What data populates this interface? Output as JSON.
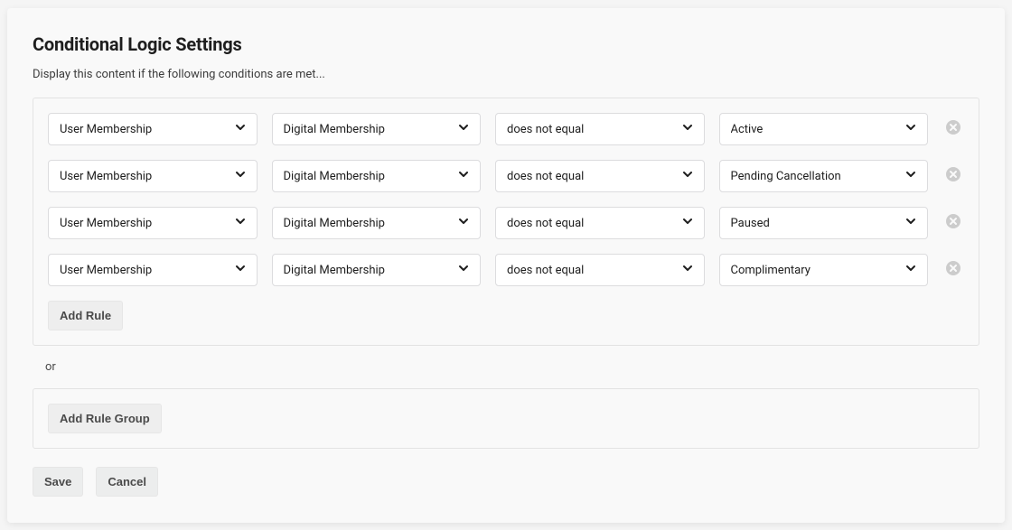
{
  "title": "Conditional Logic Settings",
  "subtitle": "Display this content if the following conditions are met...",
  "rules": [
    {
      "field": "User Membership",
      "subfield": "Digital Membership",
      "operator": "does not equal",
      "value": "Active"
    },
    {
      "field": "User Membership",
      "subfield": "Digital Membership",
      "operator": "does not equal",
      "value": "Pending Cancellation"
    },
    {
      "field": "User Membership",
      "subfield": "Digital Membership",
      "operator": "does not equal",
      "value": "Paused"
    },
    {
      "field": "User Membership",
      "subfield": "Digital Membership",
      "operator": "does not equal",
      "value": "Complimentary"
    }
  ],
  "buttons": {
    "add_rule": "Add Rule",
    "or_label": "or",
    "add_rule_group": "Add Rule Group",
    "save": "Save",
    "cancel": "Cancel"
  }
}
